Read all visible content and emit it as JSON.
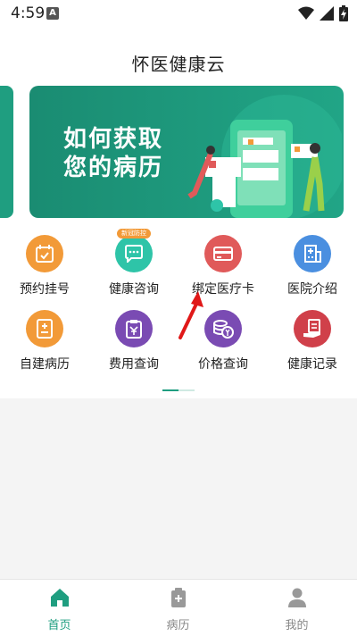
{
  "status_bar": {
    "time": "4:59",
    "notification_badge": "A",
    "icons": [
      "wifi-icon",
      "signal-icon",
      "battery-charging-icon"
    ]
  },
  "header": {
    "title": "怀医健康云"
  },
  "banner": {
    "line1": "如何获取",
    "line2": "您的病历",
    "accent_color": "#1f9e80"
  },
  "grid": {
    "items": [
      {
        "label": "预约挂号",
        "icon": "calendar-icon",
        "color": "#f29a38"
      },
      {
        "label": "健康咨询",
        "icon": "chat-icon",
        "color": "#2ec4a8",
        "badge": "新冠防控"
      },
      {
        "label": "绑定医疗卡",
        "icon": "card-icon",
        "color": "#e05a5a"
      },
      {
        "label": "医院介绍",
        "icon": "hospital-building-icon",
        "color": "#4a8fe0"
      },
      {
        "label": "自建病历",
        "icon": "record-plus-icon",
        "color": "#f29a38"
      },
      {
        "label": "费用查询",
        "icon": "yuan-clipboard-icon",
        "color": "#7a4bb3"
      },
      {
        "label": "价格查询",
        "icon": "coins-icon",
        "color": "#7a4bb3"
      },
      {
        "label": "健康记录",
        "icon": "hand-document-icon",
        "color": "#d0404a"
      }
    ]
  },
  "bottom_nav": {
    "items": [
      {
        "label": "首页",
        "icon": "home-icon",
        "active": true,
        "color": "#1f9e80"
      },
      {
        "label": "病历",
        "icon": "medical-record-icon",
        "active": false,
        "color": "#888888"
      },
      {
        "label": "我的",
        "icon": "profile-icon",
        "active": false,
        "color": "#888888"
      }
    ]
  }
}
